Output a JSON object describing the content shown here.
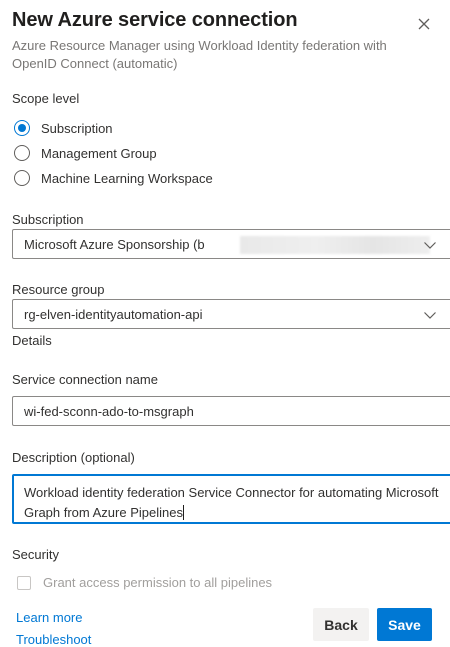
{
  "dialog": {
    "title": "New Azure service connection",
    "subtitle": "Azure Resource Manager using Workload Identity federation with OpenID Connect (automatic)"
  },
  "scope": {
    "label": "Scope level",
    "options": [
      {
        "label": "Subscription",
        "selected": true
      },
      {
        "label": "Management Group",
        "selected": false
      },
      {
        "label": "Machine Learning Workspace",
        "selected": false
      }
    ]
  },
  "subscription": {
    "label": "Subscription",
    "value": "Microsoft Azure Sponsorship (b"
  },
  "resource_group": {
    "label": "Resource group",
    "value": "rg-elven-identityautomation-api"
  },
  "details": {
    "label": "Details"
  },
  "service_connection_name": {
    "label": "Service connection name",
    "value": "wi-fed-sconn-ado-to-msgraph"
  },
  "description": {
    "label": "Description (optional)",
    "value": "Workload identity federation Service Connector for automating Microsoft Graph from Azure Pipelines"
  },
  "security": {
    "label": "Security",
    "grant_access_label": "Grant access permission to all pipelines"
  },
  "links": {
    "learn_more": "Learn more",
    "troubleshoot": "Troubleshoot"
  },
  "buttons": {
    "back": "Back",
    "save": "Save"
  },
  "colors": {
    "accent": "#0078d4",
    "text": "#323130",
    "muted": "#797775",
    "disabled": "#a19f9d"
  }
}
